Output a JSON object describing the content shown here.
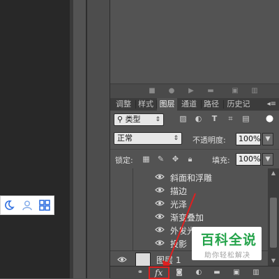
{
  "sub_toolbar": {
    "icons": [
      "square-icon",
      "circle-icon",
      "play-icon",
      "folder-icon",
      "new-page-icon",
      "trash-icon"
    ]
  },
  "tabs": {
    "items": [
      {
        "label": "调整"
      },
      {
        "label": "样式"
      },
      {
        "label": "图层"
      },
      {
        "label": "通道"
      },
      {
        "label": "路径"
      },
      {
        "label": "历史记"
      }
    ],
    "active": "图层"
  },
  "filter": {
    "kind_label": "类型",
    "icons": [
      "image-filter-icon",
      "adjustment-filter-icon",
      "text-filter-icon",
      "shape-filter-icon",
      "smart-object-filter-icon",
      "filter-toggle-icon"
    ]
  },
  "blend": {
    "mode": "正常",
    "opacity_label": "不透明度:",
    "opacity_value": "100%"
  },
  "lock": {
    "label": "锁定:",
    "fill_label": "填充:",
    "fill_value": "100%"
  },
  "effects": [
    {
      "name": "斜面和浮雕"
    },
    {
      "name": "描边"
    },
    {
      "name": "光泽"
    },
    {
      "name": "渐变叠加"
    },
    {
      "name": "外发光"
    },
    {
      "name": "投影"
    }
  ],
  "layer": {
    "name": "图层 1"
  },
  "bottom_bar": {
    "fx_label": "fx",
    "icons": [
      "link-layers-icon",
      "fx-icon",
      "add-mask-icon",
      "adjustment-layer-icon",
      "new-group-icon",
      "new-layer-icon",
      "delete-layer-icon"
    ]
  },
  "watermark": {
    "title": "百科全说",
    "subtitle": "助你轻松解决"
  },
  "colors": {
    "highlight_box": "#e02020",
    "watermark_green": "#24a34a"
  }
}
